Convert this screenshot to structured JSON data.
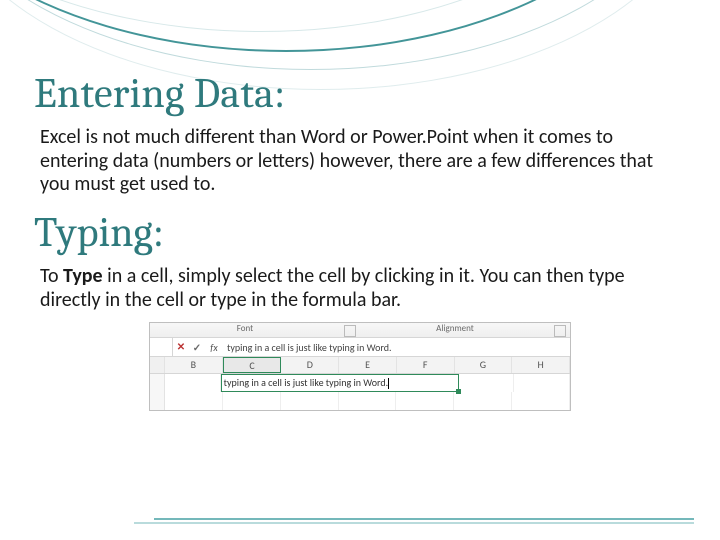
{
  "heading1": "Entering Data:",
  "para1": "Excel is not much different than Word or Power.Point when it comes to entering data (numbers or letters) however, there are a few differences that you must get used to.",
  "heading2": "Typing:",
  "para2_pre": "To ",
  "para2_bold": "Type",
  "para2_post": " in a cell, simply select the cell by clicking in it. You can then type directly in the cell or type in the formula bar.",
  "excel": {
    "ribbon_group_font": "Font",
    "ribbon_group_align": "Alignment",
    "fx_symbol": "fx",
    "x_symbol": "✕",
    "check_symbol": "✓",
    "formula_text": "typing in a cell is just like typing in Word.",
    "cols": [
      "B",
      "C",
      "D",
      "E",
      "F",
      "G",
      "H"
    ],
    "cell_text": "typing in a cell is just like typing in Word."
  }
}
